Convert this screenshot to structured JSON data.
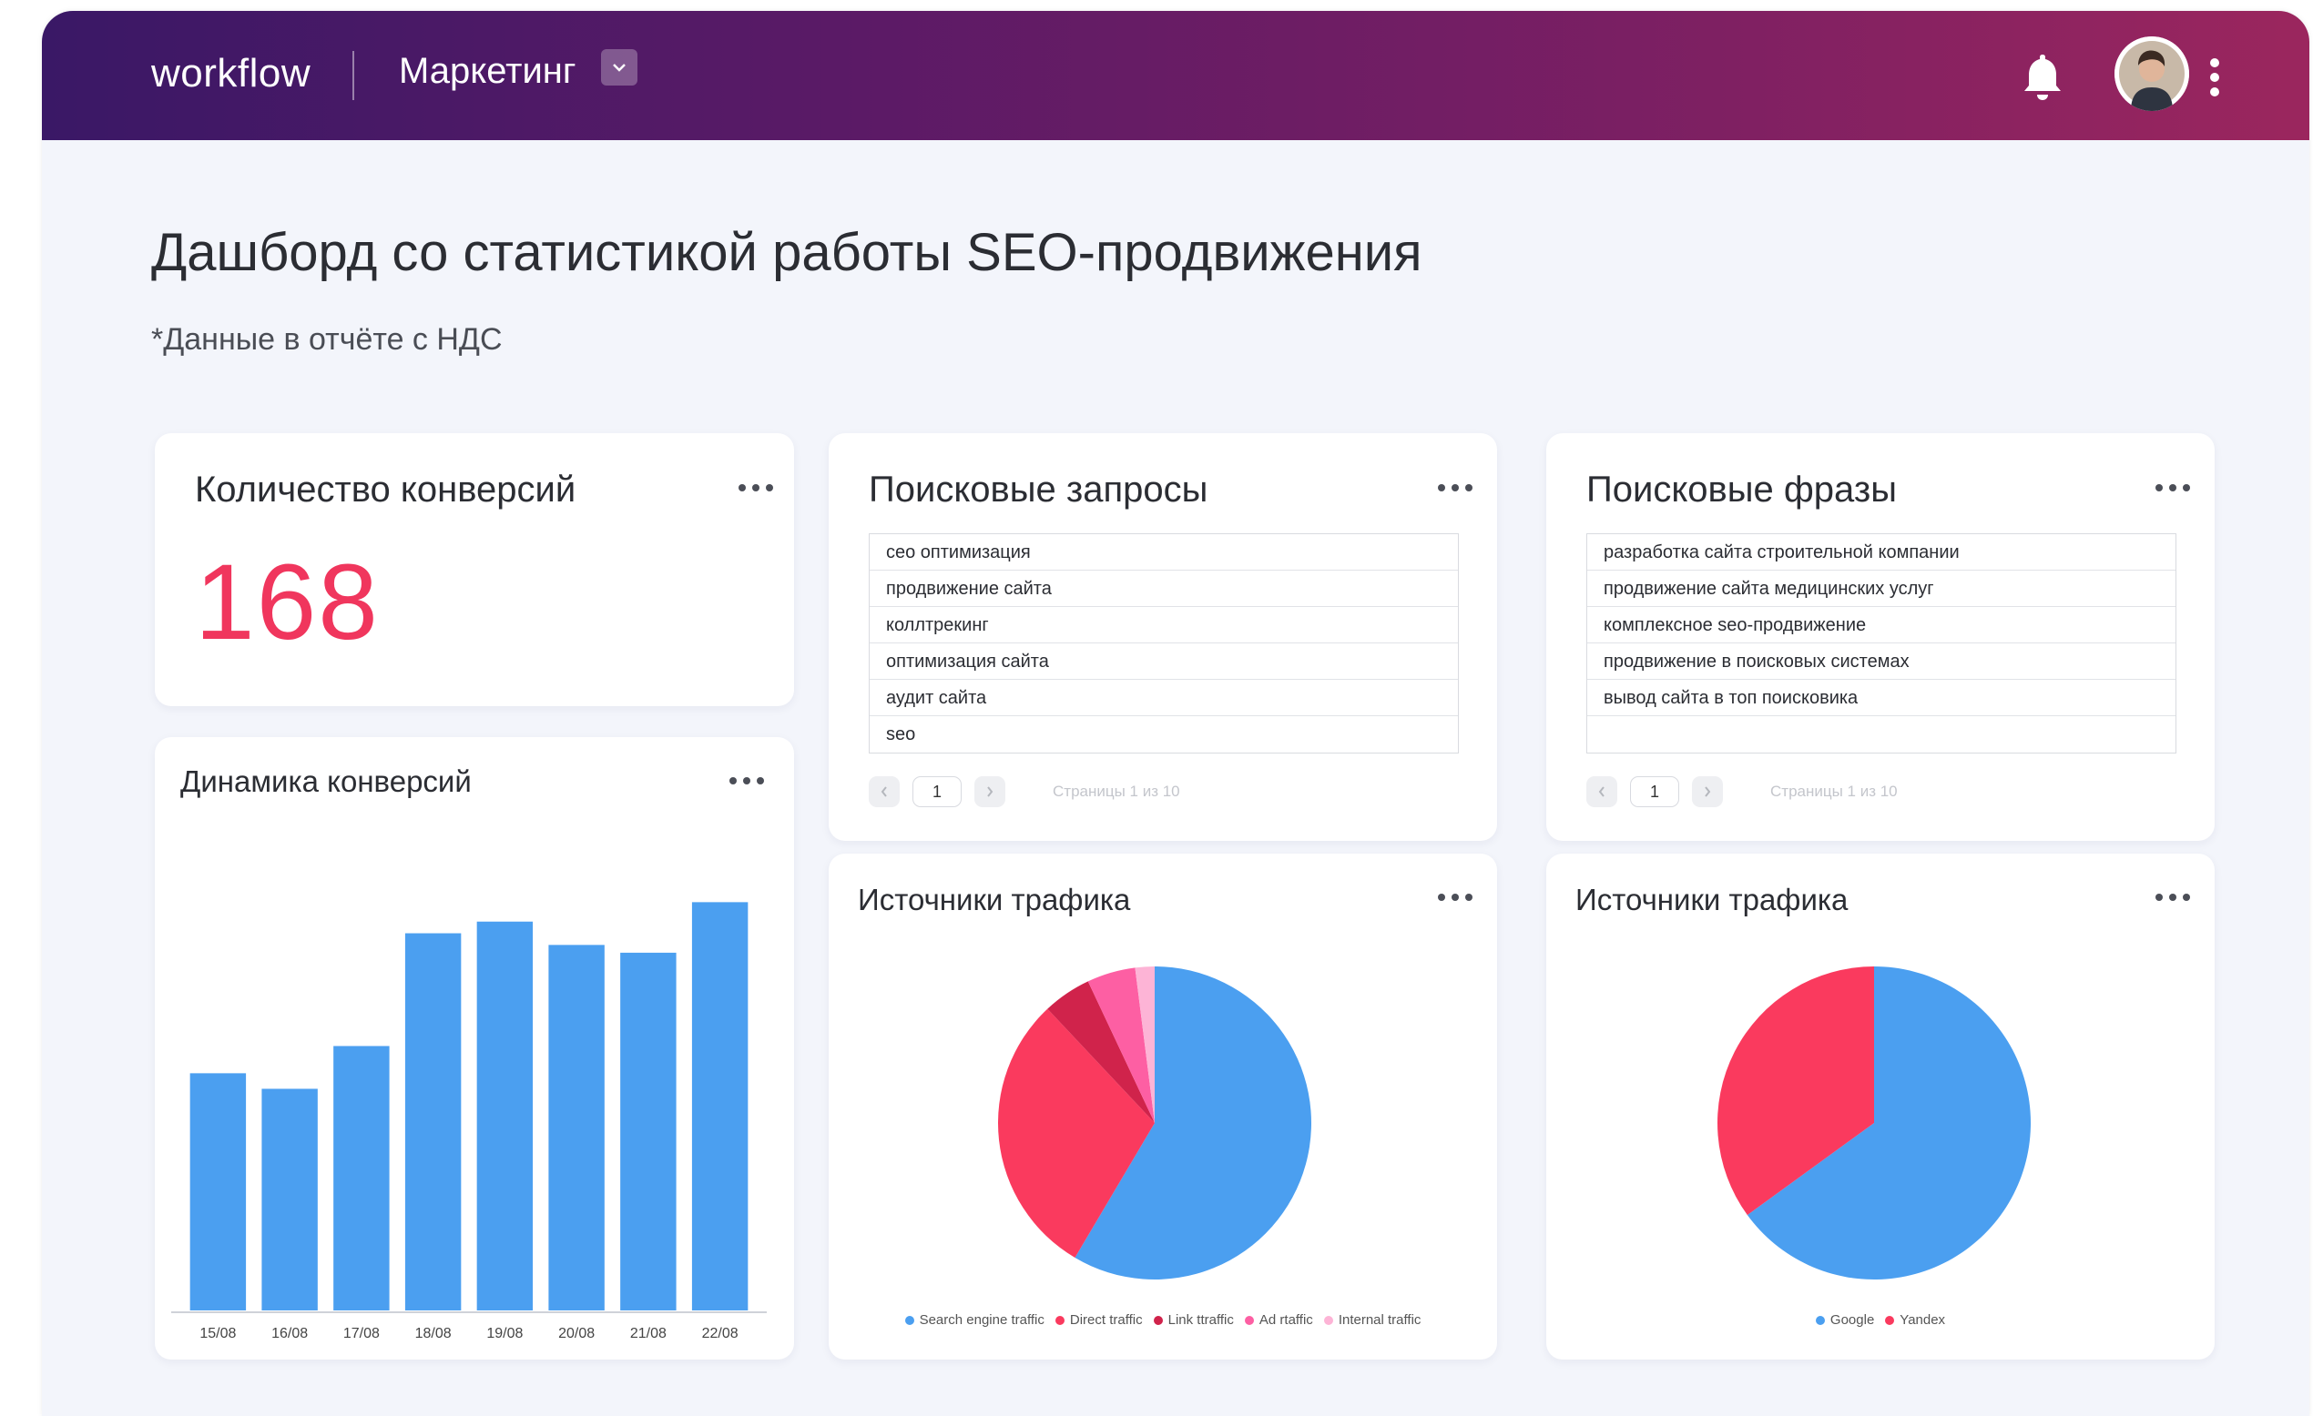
{
  "app": {
    "name": "workflow",
    "project": "Маркетинг"
  },
  "page": {
    "title": "Дашборд со статистикой работы SEO-продвижения",
    "subtitle": "*Данные в отчёте с НДС"
  },
  "conversions": {
    "title": "Количество конверсий",
    "value": "168"
  },
  "queries": {
    "title": "Поисковые запросы",
    "rows": [
      "сео оптимизация",
      "продвижение сайта",
      "коллтрекинг",
      "оптимизация сайта",
      "аудит сайта",
      "seo"
    ],
    "page": "1",
    "page_info": "Страницы 1 из 10"
  },
  "phrases": {
    "title": "Поисковые фразы",
    "rows": [
      "разработка сайта строительной компании",
      "продвижение сайта медицинских услуг",
      "комплексное seo-продвижение",
      "продвижение в поисковых системах",
      "вывод сайта в топ поисковика",
      ""
    ],
    "page": "1",
    "page_info": "Страницы 1 из 10"
  },
  "dynamics": {
    "title": "Динамика конверсий"
  },
  "traffic1": {
    "title": "Источники трафика"
  },
  "traffic2": {
    "title": "Источники трафика"
  },
  "colors": {
    "accent": "#f0365d",
    "bar": "#4b9ff0",
    "blue": "#4b9ff0",
    "red": "#fa3a5e",
    "crimson": "#d0234b",
    "pink": "#fd5fa3",
    "lightpink": "#fdb4d6"
  },
  "icons": {
    "bell": "bell-icon",
    "menu": "kebab-menu-icon",
    "more": "more-horizontal-icon",
    "dropdown": "chevron-down-icon"
  },
  "chart_data": [
    {
      "type": "bar",
      "title": "Динамика конверсий",
      "categories": [
        "15/08",
        "16/08",
        "17/08",
        "18/08",
        "19/08",
        "20/08",
        "21/08",
        "22/08"
      ],
      "values": [
        61,
        57,
        68,
        97,
        100,
        94,
        92,
        105
      ],
      "ylim": [
        0,
        110
      ],
      "grid": false,
      "legend": "none"
    },
    {
      "type": "pie",
      "title": "Источники трафика",
      "labels": [
        "Search engine traffic",
        "Direct traffic",
        "Link ttraffic",
        "Ad rtaffic",
        "Internal traffic"
      ],
      "values": [
        58.5,
        29.5,
        5,
        5,
        2
      ],
      "legend": "bottom"
    },
    {
      "type": "pie",
      "title": "Источники трафика",
      "labels": [
        "Google",
        "Yandex"
      ],
      "values": [
        65,
        35
      ],
      "legend": "bottom"
    }
  ]
}
